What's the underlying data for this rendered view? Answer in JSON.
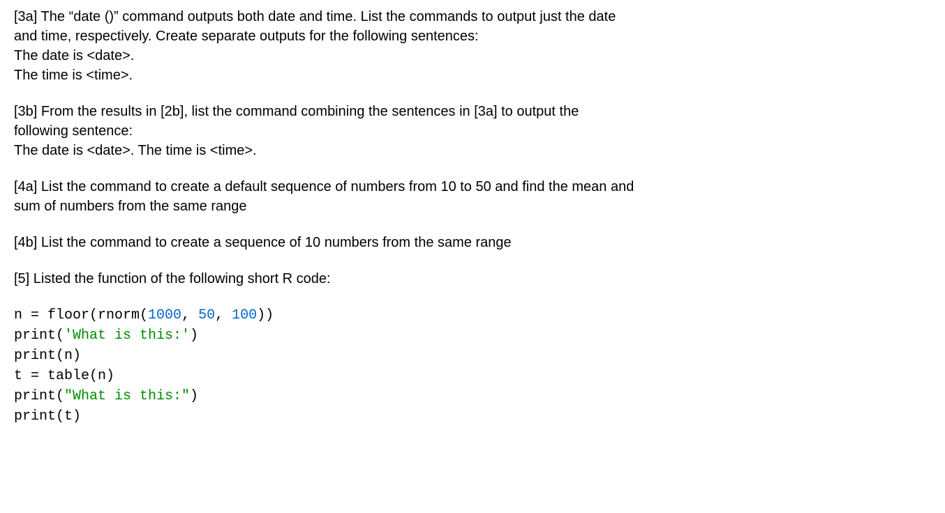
{
  "q3a": {
    "line1": "[3a] The “date ()” command outputs both date and time. List the commands to output just the date",
    "line2": "and time, respectively. Create separate outputs for the following sentences:",
    "line3": "The date is <date>.",
    "line4": "The time is <time>."
  },
  "q3b": {
    "line1": "[3b] From the results in [2b], list the command combining the sentences in [3a] to output the",
    "line2": "following sentence:",
    "line3": "The date is <date>. The time is <time>."
  },
  "q4a": {
    "line1": "[4a] List the command to create a default sequence of numbers from 10 to 50 and find the mean and",
    "line2": "sum of numbers from the same range"
  },
  "q4b": {
    "line1": "[4b] List the command to create a sequence of 10 numbers from the same range"
  },
  "q5": {
    "line1": "[5] Listed the function of the following short R code:"
  },
  "code": {
    "l1_a": "n = ",
    "l1_b": "floor(rnorm(",
    "l1_num1": "1000",
    "l1_c": ", ",
    "l1_num2": "50",
    "l1_d": ", ",
    "l1_num3": "100",
    "l1_e": "))",
    "l2_a": "print(",
    "l2_str": "'What is this:'",
    "l2_b": ")",
    "l3": "print(n)",
    "l4": "t = table(n)",
    "l5_a": "print(",
    "l5_str": "\"What is this:\"",
    "l5_b": ")",
    "l6": "print(t)"
  }
}
